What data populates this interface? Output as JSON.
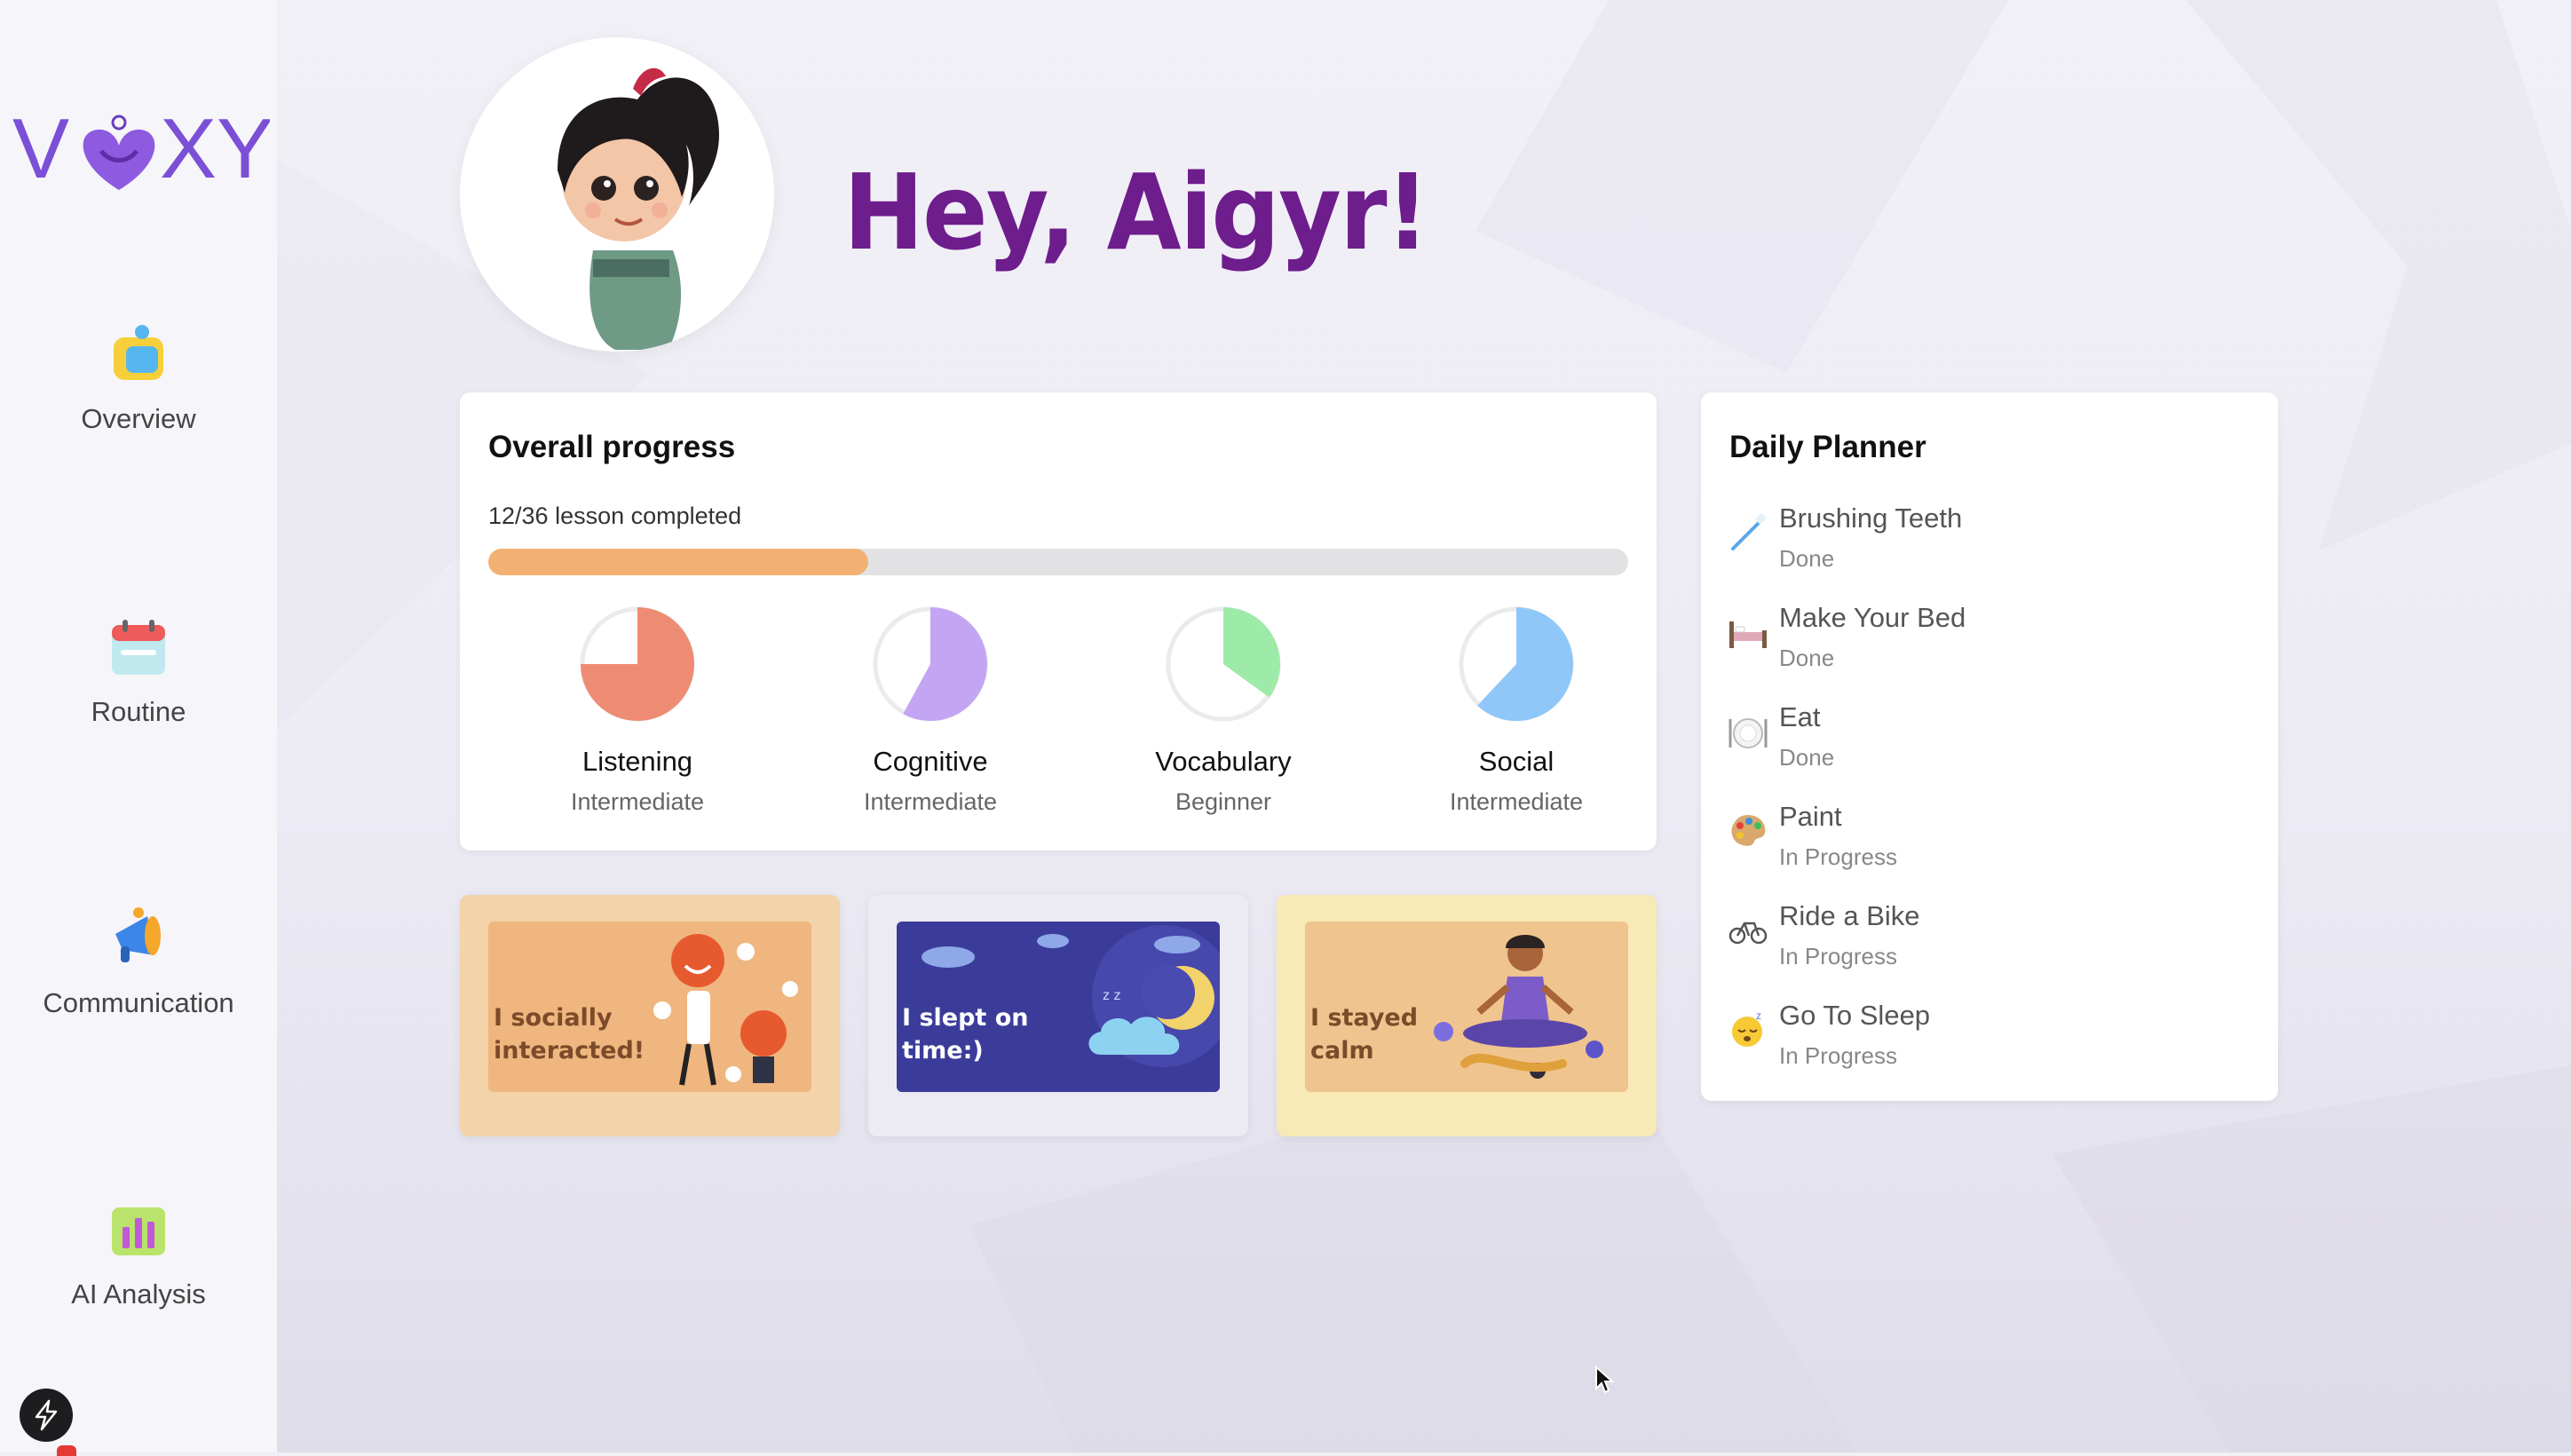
{
  "app": {
    "logo_text": "VOXY",
    "brand_color": "#7b4fd6"
  },
  "sidebar": {
    "items": [
      {
        "label": "Overview",
        "icon": "overview-icon"
      },
      {
        "label": "Routine",
        "icon": "calendar-icon"
      },
      {
        "label": "Communication",
        "icon": "megaphone-icon"
      },
      {
        "label": "AI Analysis",
        "icon": "bar-chart-icon"
      }
    ],
    "bottom_icon": "lightning-bolt-icon"
  },
  "header": {
    "greeting": "Hey, Aigyr!",
    "greeting_color": "#6e1d8c"
  },
  "progress": {
    "title": "Overall progress",
    "lessons_text": "12/36 lesson completed",
    "completed_fraction": 0.333,
    "bar_color": "#f2b172",
    "skills": [
      {
        "name": "Listening",
        "level": "Intermediate",
        "fraction": 0.75,
        "color": "#ee8c73"
      },
      {
        "name": "Cognitive",
        "level": "Intermediate",
        "fraction": 0.58,
        "color": "#c3a5f3"
      },
      {
        "name": "Vocabulary",
        "level": "Beginner",
        "fraction": 0.35,
        "color": "#9eeaa8"
      },
      {
        "name": "Social",
        "level": "Intermediate",
        "fraction": 0.62,
        "color": "#8ec7f8"
      }
    ]
  },
  "planner": {
    "title": "Daily Planner",
    "tasks": [
      {
        "name": "Brushing Teeth",
        "status": "Done",
        "icon": "toothbrush-icon"
      },
      {
        "name": "Make Your Bed",
        "status": "Done",
        "icon": "bed-icon"
      },
      {
        "name": "Eat",
        "status": "Done",
        "icon": "plate-icon"
      },
      {
        "name": "Paint",
        "status": "In Progress",
        "icon": "palette-icon"
      },
      {
        "name": "Ride a Bike",
        "status": "In Progress",
        "icon": "bicycle-icon"
      },
      {
        "name": "Go To Sleep",
        "status": "In Progress",
        "icon": "sleeping-face-icon"
      }
    ]
  },
  "achievements": [
    {
      "line1": "I socially",
      "line2": "interacted!"
    },
    {
      "line1": "I slept on",
      "line2": "time:)"
    },
    {
      "line1": "I stayed",
      "line2": "calm"
    }
  ]
}
